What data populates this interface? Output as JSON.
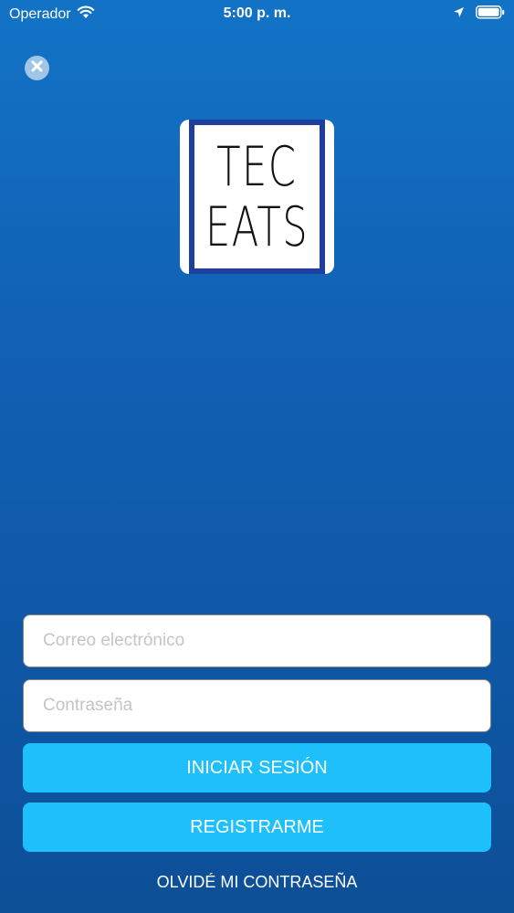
{
  "status_bar": {
    "carrier": "Operador",
    "time": "5:00 p. m."
  },
  "icons": {
    "wifi": "wifi-icon",
    "location": "location-arrow-icon",
    "battery": "battery-icon",
    "close": "close-icon"
  },
  "logo": {
    "line1": "TEC",
    "line2": "EATS"
  },
  "form": {
    "email_placeholder": "Correo electrónico",
    "email_value": "",
    "password_placeholder": "Contraseña",
    "password_value": ""
  },
  "buttons": {
    "login_label": "INICIAR SESIÓN",
    "register_label": "REGISTRARME",
    "forgot_label": "OLVIDÉ MI CONTRASEÑA"
  },
  "colors": {
    "background_top": "#1273c6",
    "background_bottom": "#0d4f97",
    "button": "#1ec0fb",
    "logo_frame": "#1f3f9c"
  }
}
